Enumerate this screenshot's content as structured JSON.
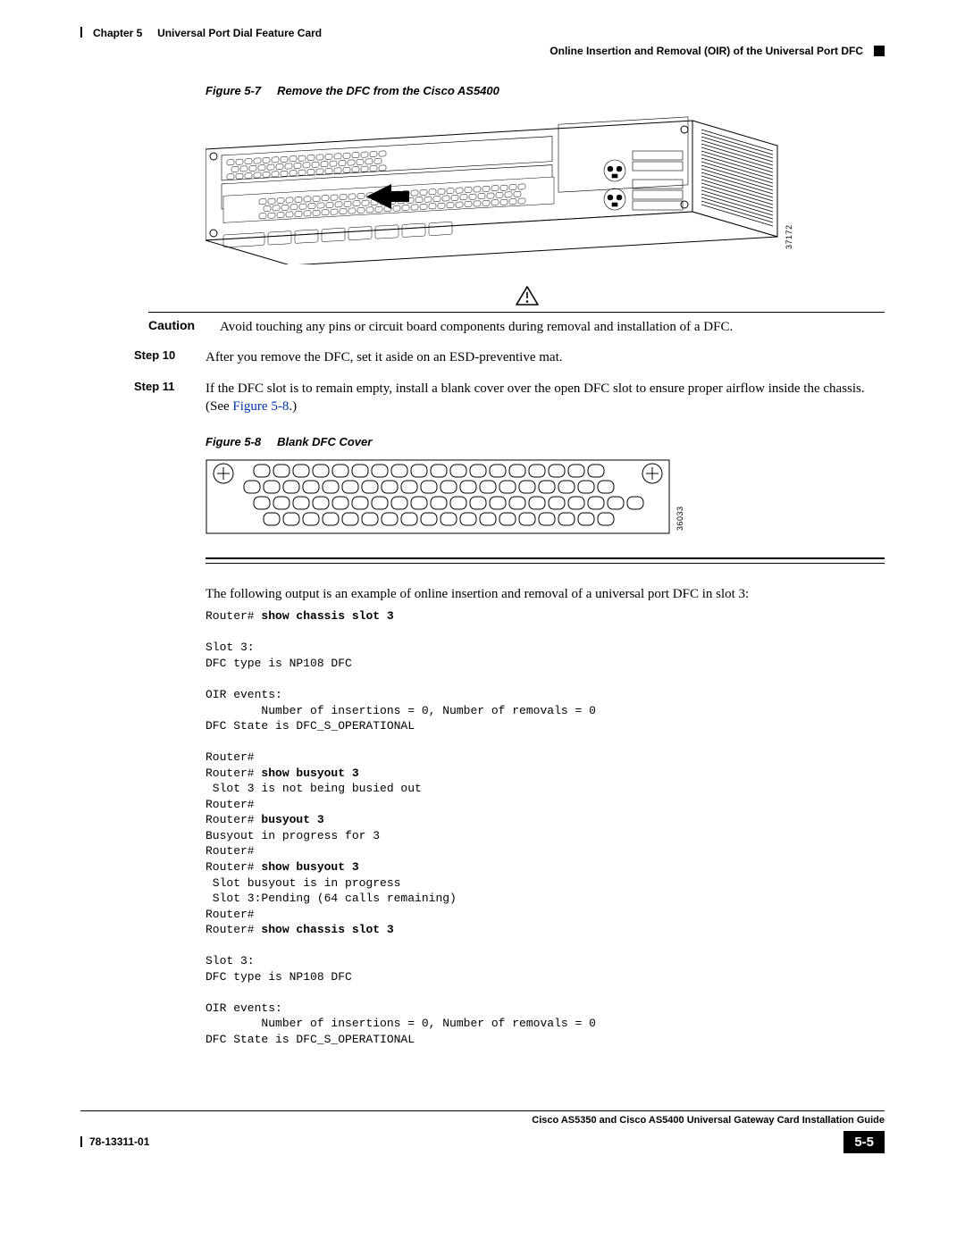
{
  "header": {
    "chapter_label": "Chapter 5",
    "chapter_title": "Universal Port Dial Feature Card",
    "section_title": "Online Insertion and Removal (OIR) of the Universal Port DFC"
  },
  "figure7": {
    "label": "Figure 5-7",
    "title": "Remove the DFC from the Cisco AS5400",
    "image_number": "37172"
  },
  "caution": {
    "label": "Caution",
    "text": "Avoid touching any pins or circuit board components during removal and installation of a DFC."
  },
  "steps": [
    {
      "label": "Step 10",
      "text": "After you remove the DFC, set it aside on an ESD-preventive mat."
    },
    {
      "label": "Step 11",
      "text_a": "If the DFC slot is to remain empty, install a blank cover over the open DFC slot to ensure proper airflow inside the chassis. (See ",
      "link": "Figure 5-8",
      "text_b": ".)"
    }
  ],
  "figure8": {
    "label": "Figure 5-8",
    "title": "Blank DFC Cover",
    "image_number": "36033"
  },
  "output_intro": "The following output is an example of online insertion and removal of a universal port DFC in slot 3:",
  "cli": {
    "p1": "Router# ",
    "c1": "show chassis slot 3",
    "b1": "\nSlot 3:\nDFC type is NP108 DFC\n\nOIR events:\n        Number of insertions = 0, Number of removals = 0\nDFC State is DFC_S_OPERATIONAL\n\nRouter#\nRouter# ",
    "c2": "show busyout 3",
    "b2": "\n Slot 3 is not being busied out\nRouter#\nRouter# ",
    "c3": "busyout 3",
    "b3": "\nBusyout in progress for 3\nRouter#\nRouter# ",
    "c4": "show busyout 3",
    "b4": "\n Slot busyout is in progress\n Slot 3:Pending (64 calls remaining)\nRouter#\nRouter# ",
    "c5": "show chassis slot 3",
    "b5": "\n\nSlot 3:\nDFC type is NP108 DFC\n\nOIR events:\n        Number of insertions = 0, Number of removals = 0\nDFC State is DFC_S_OPERATIONAL"
  },
  "footer": {
    "guide_title": "Cisco AS5350 and Cisco AS5400 Universal Gateway Card Installation Guide",
    "doc_number": "78-13311-01",
    "page_number": "5-5"
  }
}
